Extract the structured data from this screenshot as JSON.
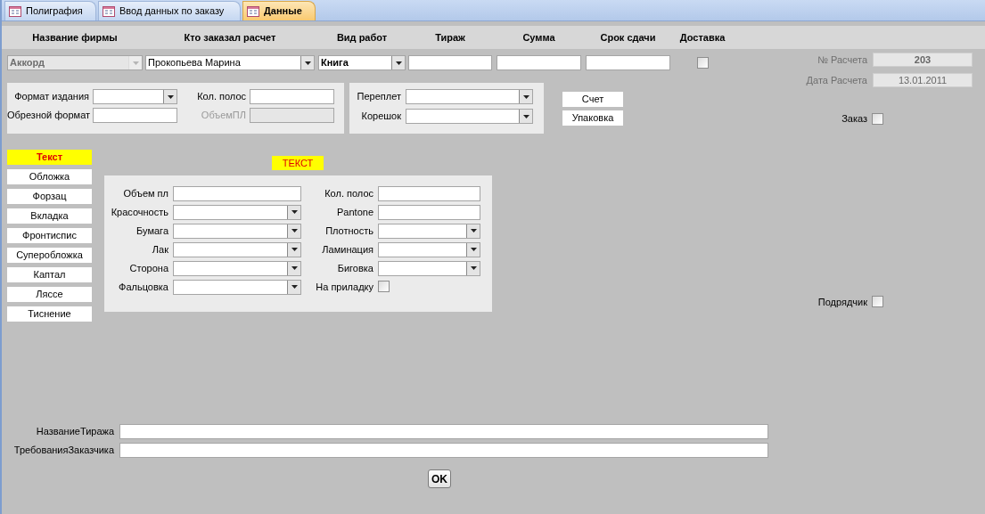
{
  "tabs": [
    {
      "label": "Полиграфия",
      "selected": false
    },
    {
      "label": "Ввод данных по заказу",
      "selected": false
    },
    {
      "label": "Данные",
      "selected": true
    }
  ],
  "top_fields": [
    {
      "header": "Название фирмы",
      "kind": "combo",
      "value": "Аккорд",
      "disabled": true
    },
    {
      "header": "Кто заказал расчет",
      "kind": "combo",
      "value": "Прокопьева Марина",
      "disabled": false
    },
    {
      "header": "Вид работ",
      "kind": "combo",
      "value": "Книга",
      "disabled": false
    },
    {
      "header": "Тираж",
      "kind": "text",
      "disabled": false
    },
    {
      "header": "Сумма",
      "kind": "text",
      "disabled": false
    },
    {
      "header": "Срок сдачи",
      "kind": "text",
      "disabled": false
    },
    {
      "header": "Доставка",
      "kind": "checkbox",
      "checked": false,
      "disabled": false
    }
  ],
  "calculation": [
    {
      "label": "№ Расчета",
      "value": "203"
    },
    {
      "label": "Дата Расчета",
      "value": "13.01.2011"
    }
  ],
  "format_panel": [
    {
      "label": "Формат издания",
      "kind": "combo",
      "disabled": false
    },
    {
      "label": "Кол. полос",
      "kind": "text",
      "disabled": false
    },
    {
      "label": "Обрезной формат",
      "kind": "text",
      "disabled": false
    },
    {
      "label": "ОбъемПЛ",
      "kind": "text",
      "disabled": true
    }
  ],
  "binding_panel": [
    {
      "label": "Переплет",
      "kind": "combo"
    },
    {
      "label": "Корешок",
      "kind": "combo"
    }
  ],
  "buttons": [
    "Счет",
    "Упаковка"
  ],
  "order": {
    "label": "Заказ",
    "checked": false
  },
  "sections": [
    {
      "label": "Текст",
      "selected": true
    },
    {
      "label": "Обложка",
      "selected": false
    },
    {
      "label": "Форзац",
      "selected": false
    },
    {
      "label": "Вкладка",
      "selected": false
    },
    {
      "label": "Фронтиспис",
      "selected": false
    },
    {
      "label": "Суперобложка",
      "selected": false
    },
    {
      "label": "Каптал",
      "selected": false
    },
    {
      "label": "Ляссе",
      "selected": false
    },
    {
      "label": "Тиснение",
      "selected": false
    }
  ],
  "section_title": "ТЕКСТ",
  "text_panel": [
    {
      "label": "Объем пл",
      "kind": "text"
    },
    {
      "label": "Кол. полос",
      "kind": "text"
    },
    {
      "label": "Красочность",
      "kind": "combo"
    },
    {
      "label": "Pantone",
      "kind": "text"
    },
    {
      "label": "Бумага",
      "kind": "combo"
    },
    {
      "label": "Плотность",
      "kind": "combo"
    },
    {
      "label": "Лак",
      "kind": "combo"
    },
    {
      "label": "Ламинация",
      "kind": "combo"
    },
    {
      "label": "Сторона",
      "kind": "combo"
    },
    {
      "label": "Биговка",
      "kind": "combo"
    },
    {
      "label": "Фальцовка",
      "kind": "combo"
    },
    {
      "label": "На приладку",
      "kind": "checkbox",
      "checked": false
    }
  ],
  "contractor": {
    "label": "Подрядчик",
    "checked": false
  },
  "bottom_fields": [
    {
      "label": "НазваниеТиража"
    },
    {
      "label": "ТребованияЗаказчика"
    }
  ],
  "ok_button": "OK"
}
